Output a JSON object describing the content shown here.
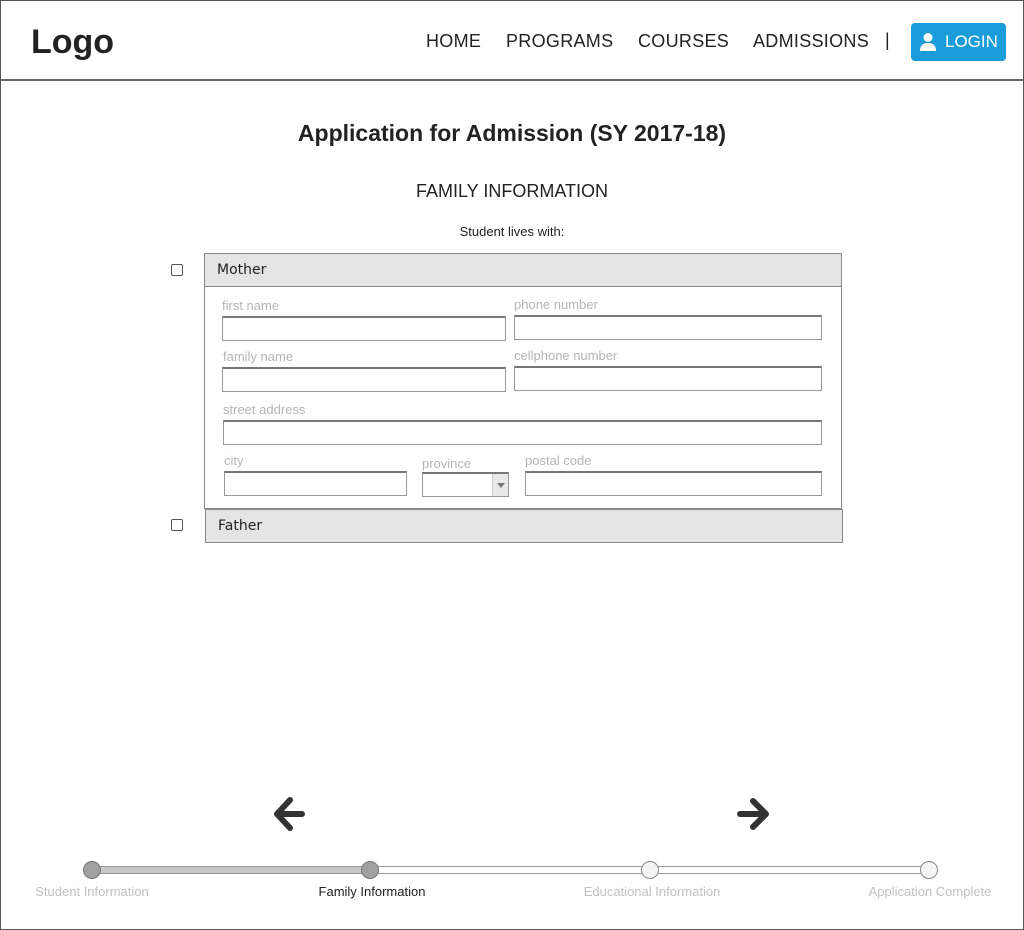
{
  "header": {
    "logo": "Logo",
    "nav": [
      "HOME",
      "PROGRAMS",
      "COURSES",
      "ADMISSIONS"
    ],
    "separator": "|",
    "login_label": "LOGIN",
    "login_icon": "user-icon",
    "accent_color": "#1a9cd8"
  },
  "main": {
    "title": "Application for Admission (SY 2017-18)",
    "section_title": "FAMILY INFORMATION",
    "lives_with_label": "Student lives with:"
  },
  "panels": {
    "mother": {
      "label": "Mother",
      "checked": false,
      "fields": {
        "first_name": "first name",
        "phone_number": "phone number",
        "family_name": "family name",
        "cellphone_number": "cellphone number",
        "street_address": "street address",
        "city": "city",
        "province": "province",
        "postal_code": "postal code"
      }
    },
    "father": {
      "label": "Father",
      "checked": false
    }
  },
  "navigation": {
    "prev_icon": "arrow-left-icon",
    "next_icon": "arrow-right-icon"
  },
  "progress": {
    "current_step": 2,
    "steps": [
      {
        "label": "Student Information",
        "state": "done"
      },
      {
        "label": "Family Information",
        "state": "current"
      },
      {
        "label": "Educational Information",
        "state": "todo"
      },
      {
        "label": "Application Complete",
        "state": "todo"
      }
    ]
  }
}
